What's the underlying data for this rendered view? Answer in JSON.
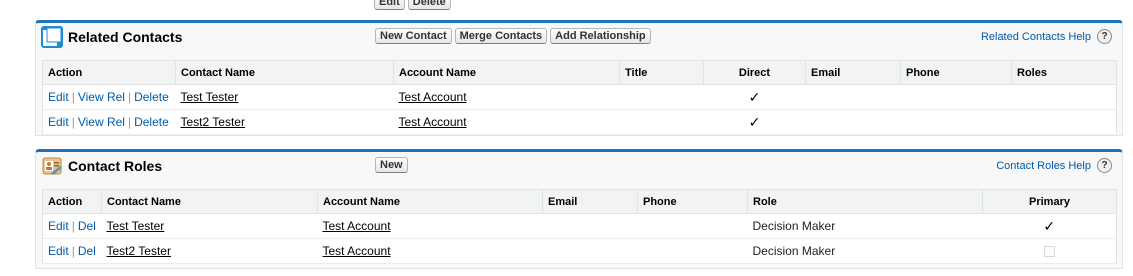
{
  "top": {
    "edit_label": "Edit",
    "delete_label": "Delete"
  },
  "related_contacts": {
    "title": "Related Contacts",
    "buttons": [
      "New Contact",
      "Merge Contacts",
      "Add Relationship"
    ],
    "help_label": "Related Contacts Help",
    "help_icon": "?",
    "columns": [
      "Action",
      "Contact Name",
      "Account Name",
      "Title",
      "Direct",
      "Email",
      "Phone",
      "Roles"
    ],
    "rows": [
      {
        "actions": [
          "Edit",
          "View Rel",
          "Delete"
        ],
        "contact": "Test Tester",
        "account": "Test Account",
        "title": "",
        "direct": "✓",
        "email": "",
        "phone": "",
        "roles": ""
      },
      {
        "actions": [
          "Edit",
          "View Rel",
          "Delete"
        ],
        "contact": "Test2 Tester",
        "account": "Test Account",
        "title": "",
        "direct": "✓",
        "email": "",
        "phone": "",
        "roles": ""
      }
    ]
  },
  "contact_roles": {
    "title": "Contact Roles",
    "buttons": [
      "New"
    ],
    "help_label": "Contact Roles Help",
    "help_icon": "?",
    "columns": [
      "Action",
      "Contact Name",
      "Account Name",
      "Email",
      "Phone",
      "Role",
      "Primary"
    ],
    "rows": [
      {
        "actions": [
          "Edit",
          "Del"
        ],
        "contact": "Test Tester",
        "account": "Test Account",
        "email": "",
        "phone": "",
        "role": "Decision Maker",
        "primary": "✓"
      },
      {
        "actions": [
          "Edit",
          "Del"
        ],
        "contact": "Test2 Tester",
        "account": "Test Account",
        "email": "",
        "phone": "",
        "role": "Decision Maker",
        "primary": ""
      }
    ]
  }
}
